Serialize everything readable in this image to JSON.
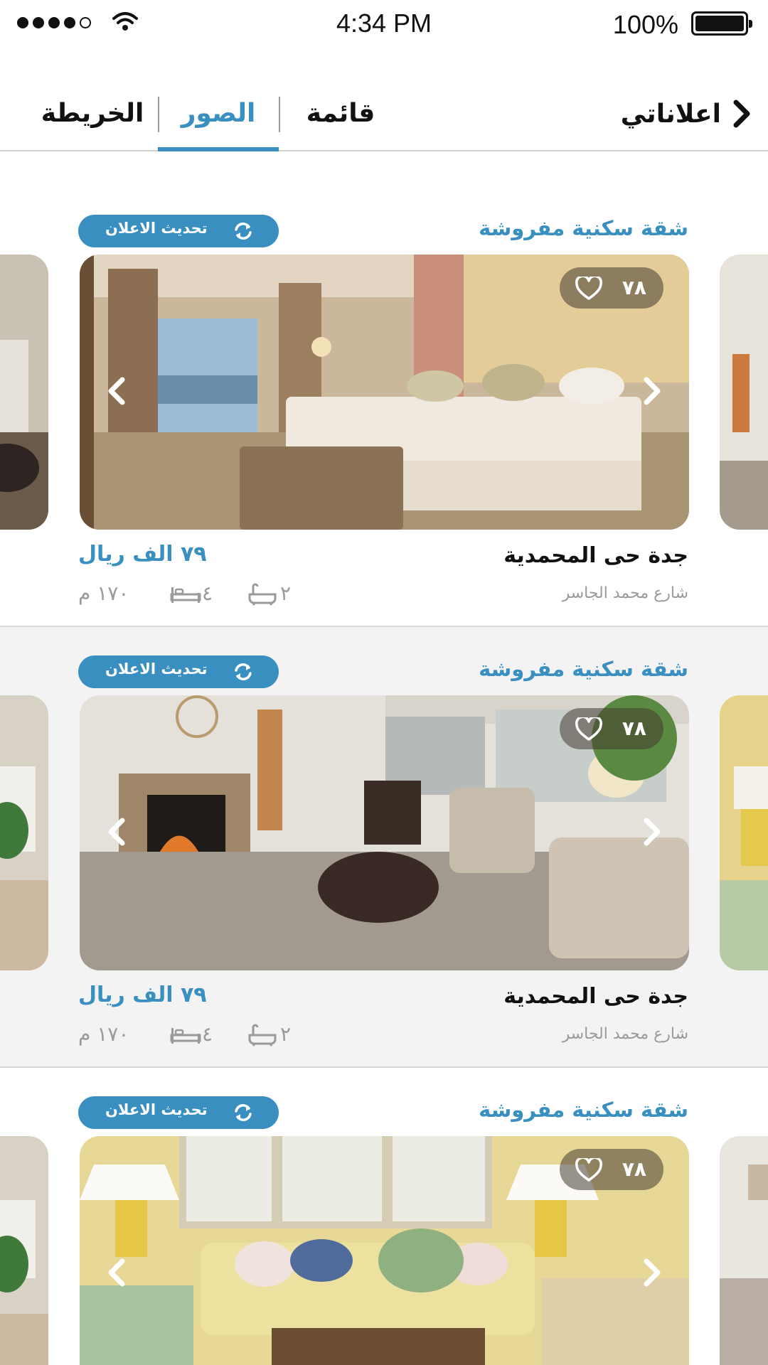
{
  "status_bar": {
    "time": "4:34 PM",
    "battery": "100%"
  },
  "header": {
    "back_label": "اعلاناتي",
    "tabs": [
      {
        "label": "الخريطة",
        "active": false
      },
      {
        "label": "الصور",
        "active": true
      },
      {
        "label": "قائمة",
        "active": false
      }
    ],
    "accent_color": "#3a8fc1"
  },
  "listings": [
    {
      "title": "شقة سكنية مفروشة",
      "update_button": "تحديث الاعلان",
      "favorites": "٧٨",
      "city": "جدة حى المحمدية",
      "street": "شارع محمد الجاسر",
      "price": "٧٩ الف ريال",
      "area": "١٧٠ م",
      "bedrooms": "٤",
      "bathrooms": "٢",
      "photo": "hotel-bedroom"
    },
    {
      "title": "شقة سكنية مفروشة",
      "update_button": "تحديث الاعلان",
      "favorites": "٧٨",
      "city": "جدة حى المحمدية",
      "street": "شارع محمد الجاسر",
      "price": "٧٩ الف ريال",
      "area": "١٧٠ م",
      "bedrooms": "٤",
      "bathrooms": "٢",
      "photo": "living-room-fireplace"
    },
    {
      "title": "شقة سكنية مفروشة",
      "update_button": "تحديث الاعلان",
      "favorites": "٧٨",
      "photo": "yellow-living-room"
    }
  ]
}
